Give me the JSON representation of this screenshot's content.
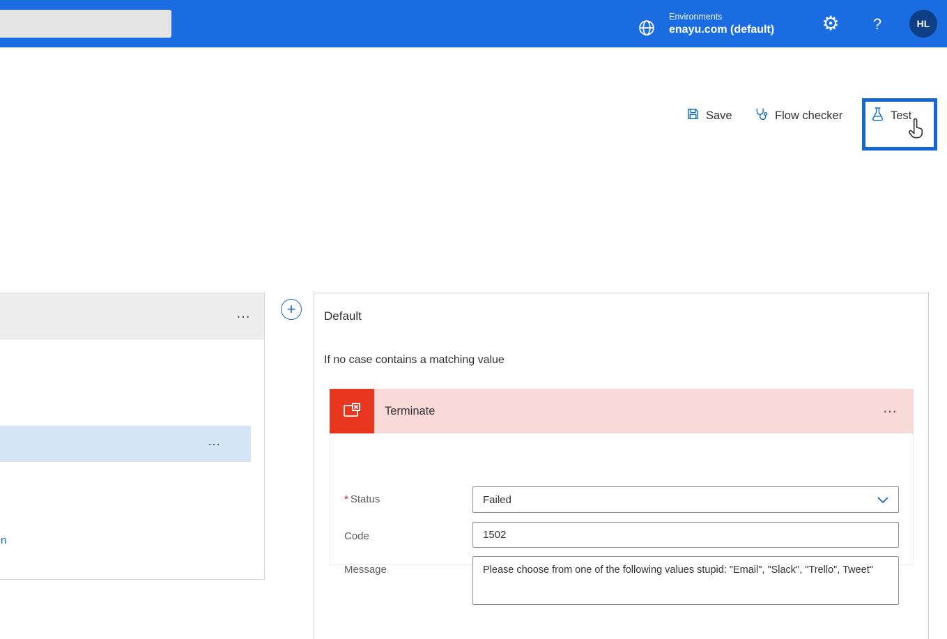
{
  "topbar": {
    "search_placeholder": "",
    "environments_label": "Environments",
    "environment_name": "enayu.com (default)",
    "help_label": "?",
    "avatar_initials": "HL"
  },
  "icons": {
    "gear": "⚙",
    "ellipsis": "⋯",
    "plus": "+"
  },
  "toolbar": {
    "save_label": "Save",
    "flow_checker_label": "Flow checker",
    "test_label": "Test"
  },
  "canvas": {
    "switch_card": {
      "link_fragment": "n"
    },
    "default_case": {
      "title": "Default",
      "subtitle": "If no case contains a matching value",
      "terminate": {
        "title": "Terminate",
        "required_marker": "*",
        "fields": [
          {
            "label": "Status",
            "value": "Failed"
          },
          {
            "label": "Code",
            "value": "1502"
          },
          {
            "label": "Message",
            "value": "Please choose from one of the following values stupid: \"Email\", \"Slack\", \"Trello\", Tweet\""
          }
        ]
      }
    }
  },
  "colors": {
    "header_blue": "#1b6ce0",
    "highlight_blue": "#1566d6",
    "accent_blue": "#0f6cbd",
    "terminate_red": "#e8361f",
    "terminate_pink": "#f8dbd8",
    "selected_row_blue": "#d3e5f4",
    "avatar_navy": "#0e3f85"
  }
}
